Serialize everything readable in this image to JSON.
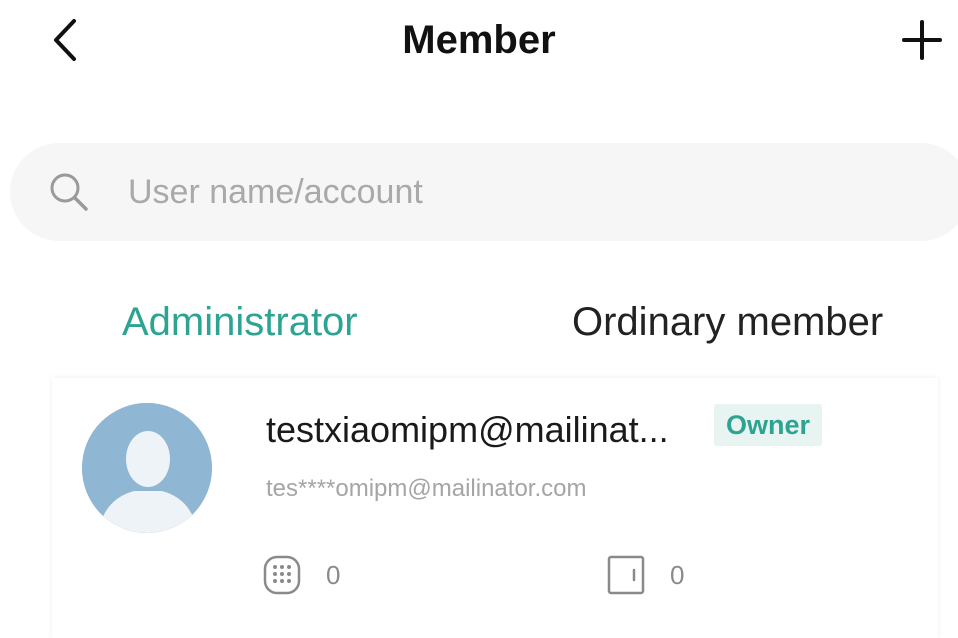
{
  "header": {
    "title": "Member",
    "back_icon": "chevron-left-icon",
    "add_icon": "plus-icon"
  },
  "search": {
    "placeholder": "User name/account",
    "value": "",
    "icon": "search-icon"
  },
  "tabs": [
    {
      "label": "Administrator",
      "active": true
    },
    {
      "label": "Ordinary member",
      "active": false
    }
  ],
  "members": [
    {
      "name": "testxiaomipm@mailinat...",
      "badge": "Owner",
      "account": "tes****omipm@mailinator.com",
      "keypad_count": "0",
      "door_count": "0",
      "avatar_icon": "default-avatar-icon"
    }
  ],
  "colors": {
    "accent": "#2da392",
    "badge_bg": "#e8f4f2",
    "search_bg": "#f6f6f6",
    "avatar_bg": "#8fb7d3"
  }
}
